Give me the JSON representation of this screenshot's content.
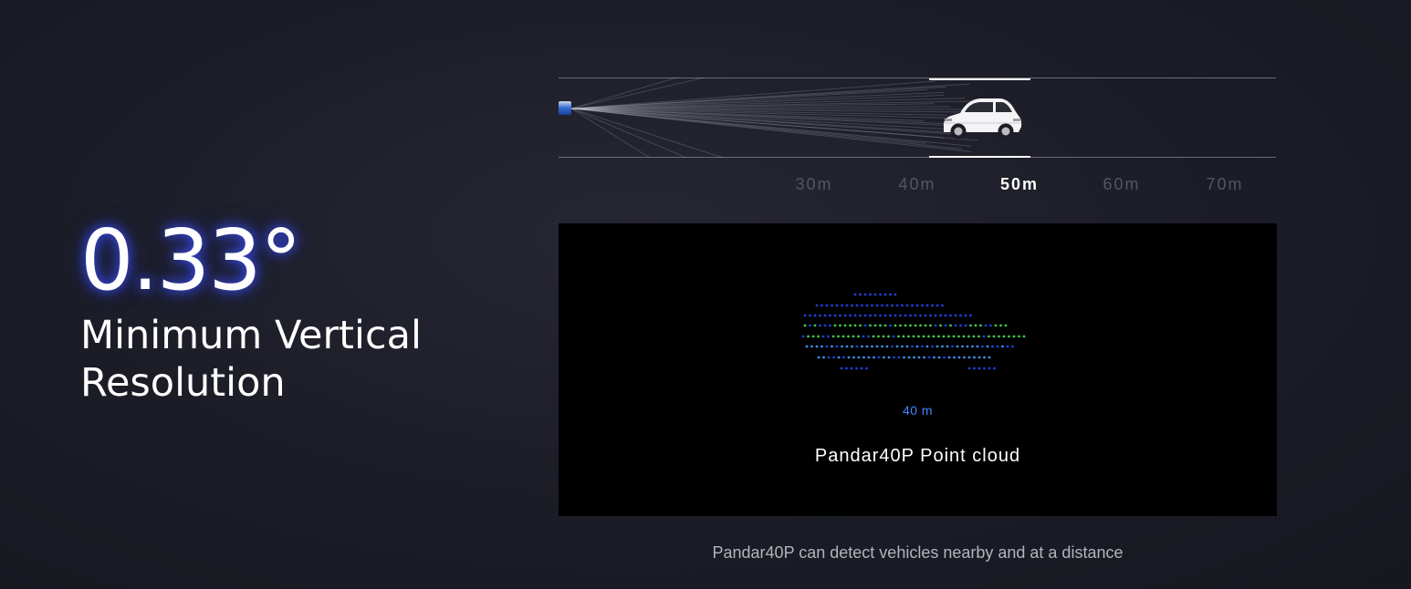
{
  "spec": {
    "value": "0.33°",
    "label": "Minimum Vertical Resolution"
  },
  "distance_scale": {
    "ticks": [
      "30m",
      "40m",
      "50m",
      "60m",
      "70m"
    ],
    "active": "50m"
  },
  "point_cloud": {
    "distance_label": "40 m",
    "title": "Pandar40P Point cloud"
  },
  "caption": "Pandar40P can detect vehicles nearby and at a distance",
  "colors": {
    "glow": "#3c50ff",
    "point_blue": "#1f3fd8",
    "point_cyan": "#3a8fe0",
    "point_green": "#3ec94a",
    "distance_label": "#3f86ff"
  },
  "icons": {
    "sensor": "lidar-sensor-icon",
    "vehicle": "suv-car-icon"
  }
}
